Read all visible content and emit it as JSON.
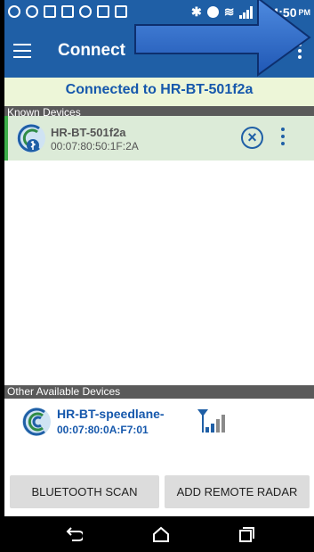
{
  "status_bar": {
    "time": "4:50",
    "ampm": "PM"
  },
  "app_bar": {
    "title": "Connect"
  },
  "banner": {
    "text": "Connected to HR-BT-501f2a"
  },
  "known_devices": {
    "header": "Known Devices",
    "items": [
      {
        "name": "HR-BT-501f2a",
        "mac": "00:07:80:50:1F:2A"
      }
    ]
  },
  "other_devices": {
    "header": "Other Available Devices",
    "items": [
      {
        "name": "HR-BT-speedlane-",
        "mac": "00:07:80:0A:F7:01"
      }
    ]
  },
  "buttons": {
    "scan": "BLUETOOTH SCAN",
    "add_radar": "ADD REMOTE RADAR"
  },
  "colors": {
    "primary": "#1f5fa6",
    "connected_bg": "#edf6d8",
    "known_row_bg": "#dcebd8",
    "accent_green": "#3cae49"
  },
  "icons": [
    "hamburger-icon",
    "overflow-menu-icon",
    "bluetooth-device-icon",
    "close-circle-icon",
    "signal-strength-icon",
    "back-icon",
    "home-icon",
    "recents-icon"
  ]
}
